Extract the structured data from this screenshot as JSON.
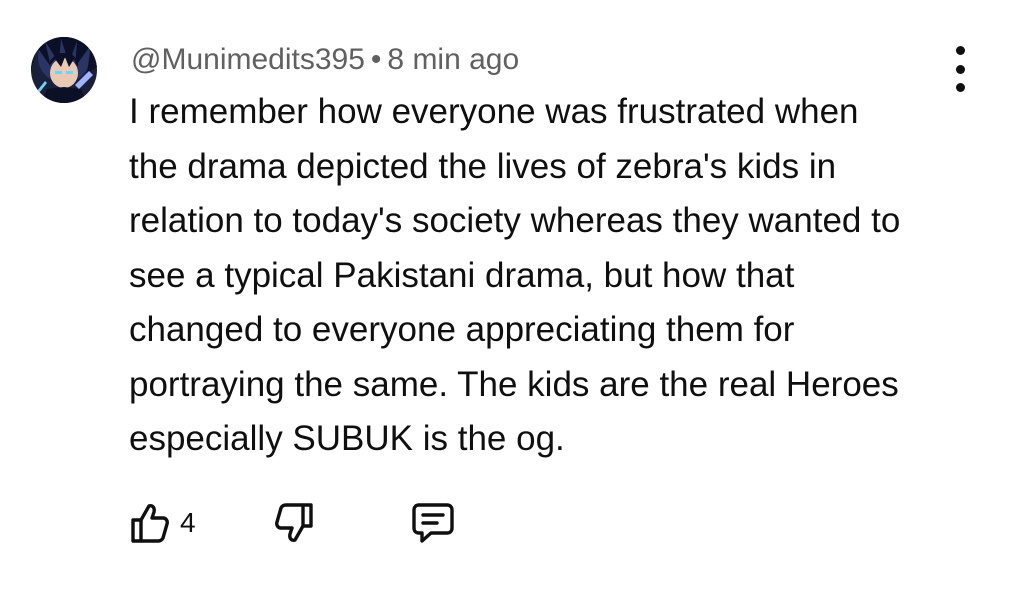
{
  "comment": {
    "author": "@Munimedits395",
    "separator": "•",
    "time": "8 min ago",
    "lines": [
      "I remember how everyone was frustrated when",
      "the drama depicted the lives of zebra's kids in",
      "relation to today's society whereas they wanted to",
      "see a typical Pakistani drama, but how that",
      "changed to everyone appreciating them for",
      "portraying the same. The kids are the real Heroes",
      "especially SUBUK is the og."
    ],
    "like_count": "4"
  },
  "icons": {
    "avatar": "avatar-image",
    "more": "more-vertical-icon",
    "like": "thumbs-up-icon",
    "dislike": "thumbs-down-icon",
    "reply": "comment-reply-icon"
  }
}
